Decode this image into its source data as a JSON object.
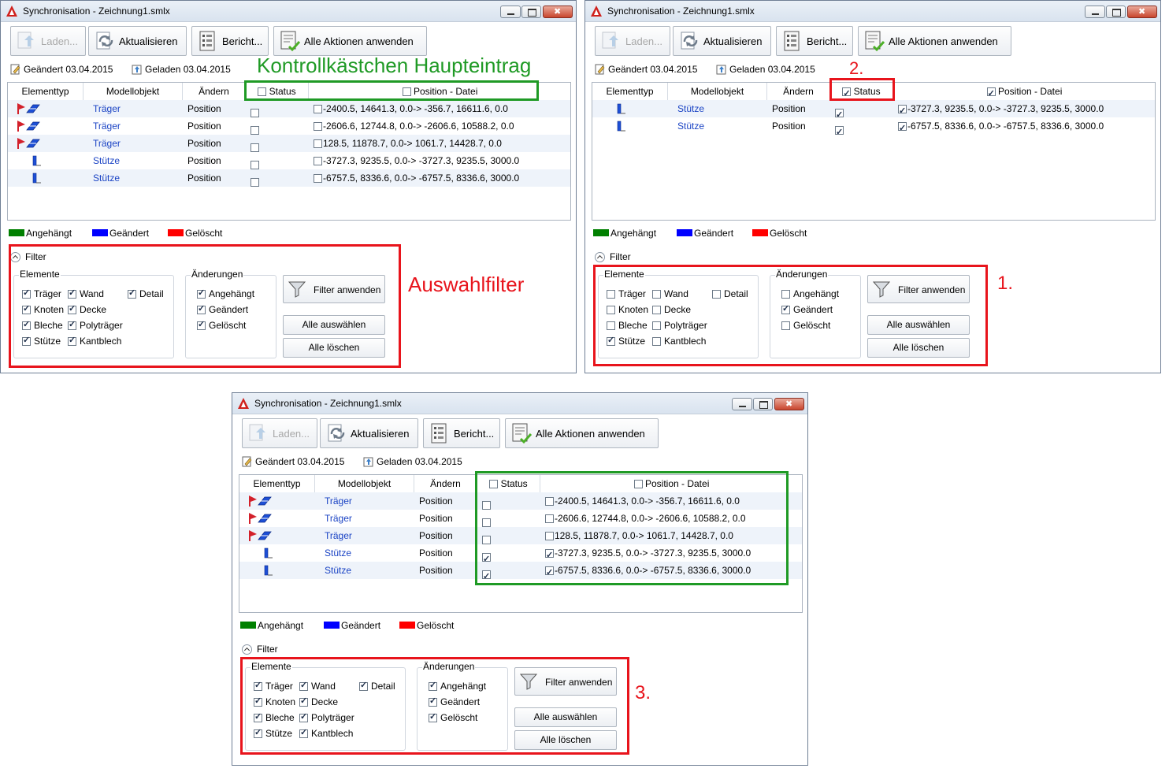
{
  "colors": {
    "green": "#008000",
    "blue": "#0000ff",
    "red": "#ff0000",
    "highlight_red": "#e8141c",
    "highlight_green": "#1f9a25",
    "link": "#1a43c4"
  },
  "window": {
    "title": "Synchronisation - Zeichnung1.smlx",
    "toolbar": {
      "laden": "Laden...",
      "aktualisieren": "Aktualisieren",
      "bericht": "Bericht...",
      "alle_aktionen": "Alle Aktionen anwenden"
    },
    "info": {
      "geaendert": "Geändert 03.04.2015",
      "geladen": "Geladen 03.04.2015"
    },
    "columns": {
      "elementtyp": "Elementtyp",
      "modellobjekt": "Modellobjekt",
      "aendern": "Ändern",
      "status": "Status",
      "position": "Position - Datei"
    },
    "legend": {
      "angehaengt": "Angehängt",
      "geaendert": "Geändert",
      "geloescht": "Gelöscht"
    },
    "filter": {
      "title": "Filter",
      "elemente_label": "Elemente",
      "aenderungen_label": "Änderungen",
      "items": {
        "traeger": "Träger",
        "wand": "Wand",
        "detail": "Detail",
        "knoten": "Knoten",
        "decke": "Decke",
        "bleche": "Bleche",
        "polytraeger": "Polyträger",
        "stuetze": "Stütze",
        "kantblech": "Kantblech",
        "angehaengt": "Angehängt",
        "geaendert": "Geändert",
        "geloescht": "Gelöscht"
      },
      "apply": "Filter anwenden",
      "select_all": "Alle auswählen",
      "clear_all": "Alle löschen"
    }
  },
  "rows_all": [
    {
      "type": "beam",
      "object": "Träger",
      "change": "Position",
      "status": false,
      "position": "-2400.5, 14641.3, 0.0-> -356.7, 16611.6, 0.0",
      "pos_checked": false
    },
    {
      "type": "beam",
      "object": "Träger",
      "change": "Position",
      "status": false,
      "position": "-2606.6, 12744.8, 0.0-> -2606.6, 10588.2, 0.0",
      "pos_checked": false
    },
    {
      "type": "beam",
      "object": "Träger",
      "change": "Position",
      "status": false,
      "position": "128.5, 11878.7, 0.0-> 1061.7, 14428.7, 0.0",
      "pos_checked": false
    },
    {
      "type": "column",
      "object": "Stütze",
      "change": "Position",
      "status": false,
      "position": "-3727.3, 9235.5, 0.0-> -3727.3, 9235.5, 3000.0",
      "pos_checked": false
    },
    {
      "type": "column",
      "object": "Stütze",
      "change": "Position",
      "status": false,
      "position": "-6757.5, 8336.6, 0.0-> -6757.5, 8336.6, 3000.0",
      "pos_checked": false
    }
  ],
  "rows_filtered": [
    {
      "type": "column",
      "object": "Stütze",
      "change": "Position",
      "status": true,
      "position": "-3727.3, 9235.5, 0.0-> -3727.3, 9235.5, 3000.0",
      "pos_checked": true
    },
    {
      "type": "column",
      "object": "Stütze",
      "change": "Position",
      "status": true,
      "position": "-6757.5, 8336.6, 0.0-> -6757.5, 8336.6, 3000.0",
      "pos_checked": true
    }
  ],
  "rows_result": [
    {
      "type": "beam",
      "object": "Träger",
      "change": "Position",
      "status": false,
      "position": "-2400.5, 14641.3, 0.0-> -356.7, 16611.6, 0.0",
      "pos_checked": false
    },
    {
      "type": "beam",
      "object": "Träger",
      "change": "Position",
      "status": false,
      "position": "-2606.6, 12744.8, 0.0-> -2606.6, 10588.2, 0.0",
      "pos_checked": false
    },
    {
      "type": "beam",
      "object": "Träger",
      "change": "Position",
      "status": false,
      "position": "128.5, 11878.7, 0.0-> 1061.7, 14428.7, 0.0",
      "pos_checked": false
    },
    {
      "type": "column",
      "object": "Stütze",
      "change": "Position",
      "status": true,
      "position": "-3727.3, 9235.5, 0.0-> -3727.3, 9235.5, 3000.0",
      "pos_checked": true
    },
    {
      "type": "column",
      "object": "Stütze",
      "change": "Position",
      "status": true,
      "position": "-6757.5, 8336.6, 0.0-> -6757.5, 8336.6, 3000.0",
      "pos_checked": true
    }
  ],
  "annotations": {
    "kontroll": "Kontrollkästchen Haupteintrag",
    "auswahl": "Auswahlfilter",
    "n1": "1.",
    "n2": "2.",
    "n3": "3."
  }
}
